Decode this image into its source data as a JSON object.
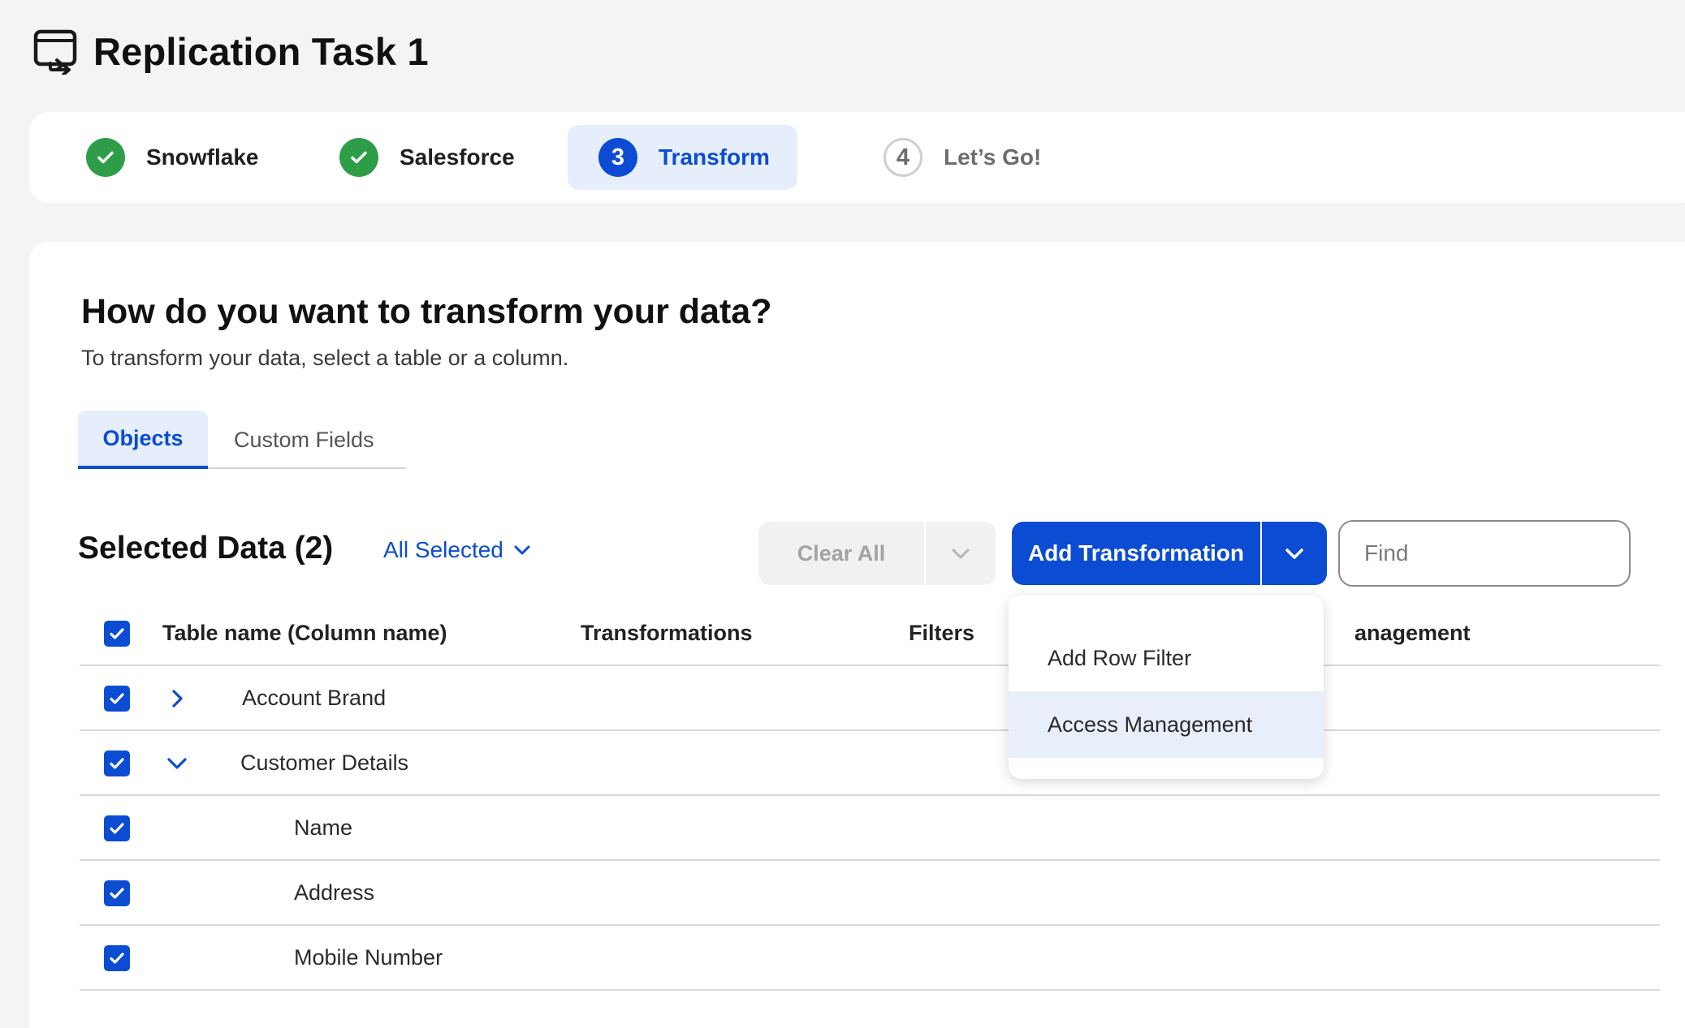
{
  "header": {
    "title": "Replication Task 1",
    "icon": "replication-task-icon"
  },
  "stepper": {
    "steps": [
      {
        "number": "1",
        "label": "Snowflake",
        "status": "done"
      },
      {
        "number": "2",
        "label": "Salesforce",
        "status": "done"
      },
      {
        "number": "3",
        "label": "Transform",
        "status": "active"
      },
      {
        "number": "4",
        "label": "Let’s Go!",
        "status": "todo"
      }
    ]
  },
  "main": {
    "title": "How do you want to transform your data?",
    "subtitle": "To transform your data, select a table or a column.",
    "tabs": [
      {
        "label": "Objects",
        "active": true
      },
      {
        "label": "Custom Fields",
        "active": false
      }
    ],
    "selected_title": "Selected Data (2)",
    "all_selected": "All Selected",
    "clear_all": "Clear All",
    "add_transformation": "Add Transformation",
    "find_placeholder": "Find"
  },
  "table": {
    "columns": [
      "Table name (Column name)",
      "Transformations",
      "Filters",
      "anagement"
    ],
    "rows": [
      {
        "name": "Account Brand",
        "level": 0,
        "expanded": false,
        "checked": true
      },
      {
        "name": "Customer Details",
        "level": 0,
        "expanded": true,
        "checked": true
      },
      {
        "name": "Name",
        "level": 1,
        "checked": true
      },
      {
        "name": "Address",
        "level": 1,
        "checked": true
      },
      {
        "name": "Mobile Number",
        "level": 1,
        "checked": true
      }
    ]
  },
  "dropdown_menu": {
    "items": [
      {
        "label": "Add Row Filter",
        "highlighted": false
      },
      {
        "label": "Access Management",
        "highlighted": true
      }
    ]
  },
  "colors": {
    "primary": "#0b4cd3",
    "success": "#2e9d47",
    "active_bg": "#e6eefc",
    "page_bg": "#f4f4f4"
  }
}
